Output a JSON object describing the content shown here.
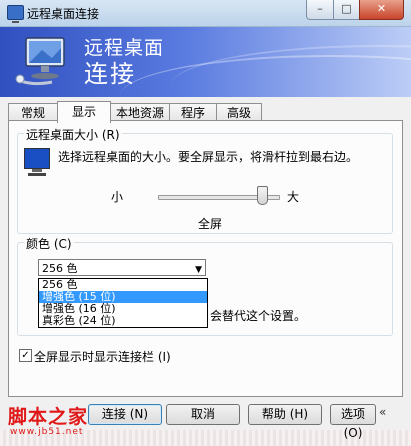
{
  "window": {
    "title": "远程桌面连接",
    "controls": {
      "minimize": "–",
      "maximize": "□",
      "close": "✕"
    }
  },
  "banner": {
    "line1": "远程桌面",
    "line2": "连接",
    "logo_icon": "remote-desktop-logo-icon"
  },
  "tabs": [
    {
      "label": "常规",
      "active": false
    },
    {
      "label": "显示",
      "active": true
    },
    {
      "label": "本地资源",
      "active": false
    },
    {
      "label": "程序",
      "active": false
    },
    {
      "label": "高级",
      "active": false
    }
  ],
  "display_size": {
    "legend": "远程桌面大小 (R)",
    "icon": "monitor-icon",
    "description": "选择远程桌面的大小。要全屏显示，将滑杆拉到最右边。",
    "slider_min_label": "小",
    "slider_max_label": "大",
    "slider_value_label": "全屏",
    "slider_position": 1.0
  },
  "colors": {
    "legend": "颜色 (C)",
    "selected": "256 色",
    "options": [
      {
        "label": "256 色",
        "highlighted": false
      },
      {
        "label": "增强色 (15 位)",
        "highlighted": true
      },
      {
        "label": "增强色 (16 位)",
        "highlighted": false
      },
      {
        "label": "真彩色 (24 位)",
        "highlighted": false
      }
    ],
    "note_partial": "会替代这个设置。"
  },
  "fullscreen_bar": {
    "checked": true,
    "label": "全屏显示时显示连接栏 (I)"
  },
  "buttons": {
    "connect": "连接 (N)",
    "cancel": "取消",
    "help": "帮助 (H)",
    "options": "选项 (O)",
    "options_arrows": "«"
  },
  "watermark": {
    "text": "脚本之家",
    "url": "www.jb51.net"
  },
  "colors_theme": {
    "banner_start": "#3050c0",
    "banner_end": "#bccdf6",
    "selection": "#3399ff",
    "watermark": "#e01818"
  }
}
